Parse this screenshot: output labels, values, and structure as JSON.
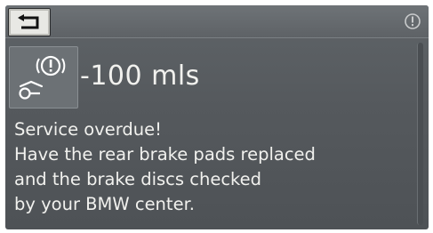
{
  "header": {
    "back_icon": "back-arrow-icon",
    "info_icon": "info-icon"
  },
  "service_item": {
    "icon": "brake-service-warning-icon",
    "distance": "-100 mls"
  },
  "message": {
    "lines": [
      "Service overdue!",
      "Have the rear brake pads replaced",
      "and the brake discs checked",
      "by your BMW center."
    ]
  },
  "colors": {
    "panel": "#55595d",
    "text": "#f1f1ee",
    "button_face": "#e8e8e4"
  }
}
